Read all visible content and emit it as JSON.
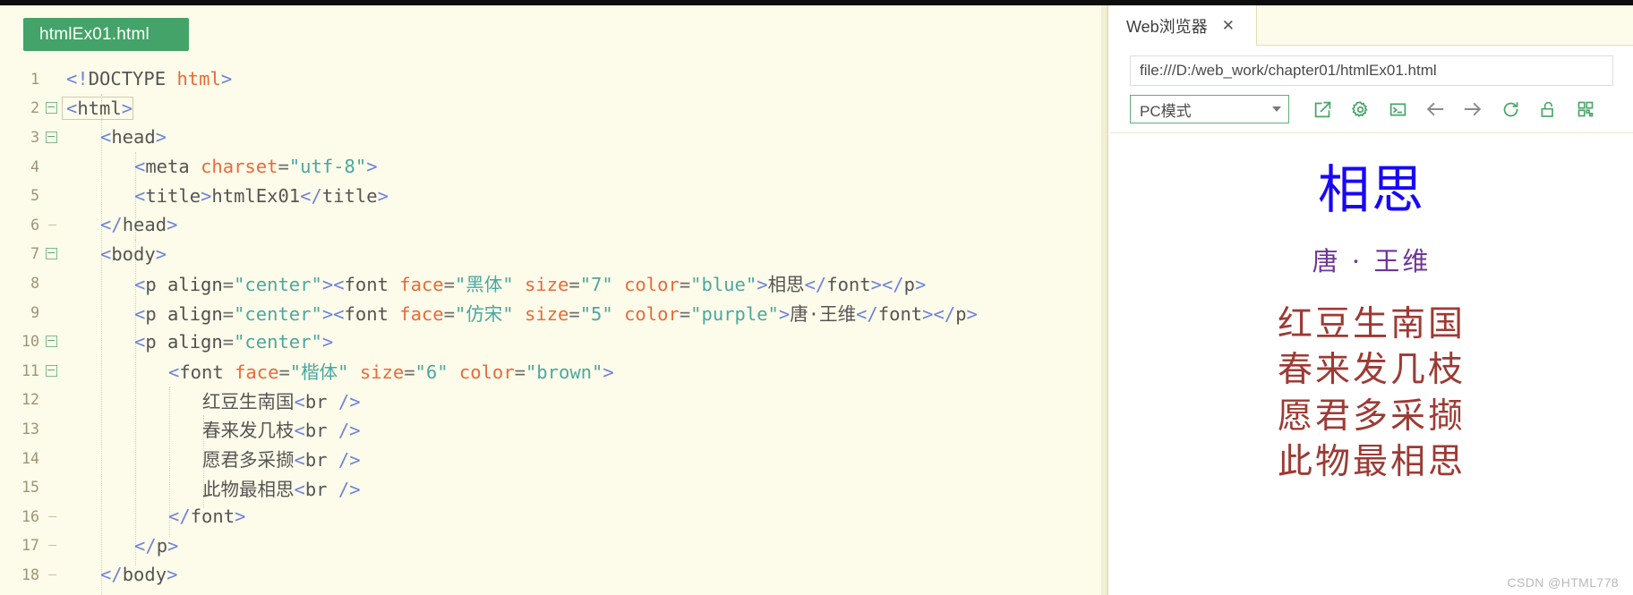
{
  "editor": {
    "file_tab_label": "htmlEx01.html",
    "lines": [
      {
        "n": "1",
        "fold": "none",
        "indent": 0,
        "tokens": [
          {
            "t": "punct",
            "v": "<!"
          },
          {
            "t": "tag",
            "v": "DOCTYPE "
          },
          {
            "t": "attr",
            "v": "html"
          },
          {
            "t": "punct",
            "v": ">"
          }
        ]
      },
      {
        "n": "2",
        "fold": "minus",
        "indent": 0,
        "boxed": true,
        "tokens": [
          {
            "t": "punct",
            "v": "<"
          },
          {
            "t": "tag",
            "v": "html"
          },
          {
            "t": "punct",
            "v": ">"
          }
        ]
      },
      {
        "n": "3",
        "fold": "minus",
        "indent": 1,
        "tokens": [
          {
            "t": "punct",
            "v": "<"
          },
          {
            "t": "tag",
            "v": "head"
          },
          {
            "t": "punct",
            "v": ">"
          }
        ]
      },
      {
        "n": "4",
        "fold": "none",
        "indent": 2,
        "tokens": [
          {
            "t": "punct",
            "v": "<"
          },
          {
            "t": "tag",
            "v": "meta "
          },
          {
            "t": "attr",
            "v": "charset"
          },
          {
            "t": "eq",
            "v": "="
          },
          {
            "t": "val",
            "v": "\"utf-8\""
          },
          {
            "t": "punct",
            "v": ">"
          }
        ]
      },
      {
        "n": "5",
        "fold": "none",
        "indent": 2,
        "tokens": [
          {
            "t": "punct",
            "v": "<"
          },
          {
            "t": "tag",
            "v": "title"
          },
          {
            "t": "punct",
            "v": ">"
          },
          {
            "t": "txt",
            "v": "htmlEx01"
          },
          {
            "t": "punct",
            "v": "</"
          },
          {
            "t": "tag",
            "v": "title"
          },
          {
            "t": "punct",
            "v": ">"
          }
        ]
      },
      {
        "n": "6",
        "fold": "tick",
        "indent": 1,
        "tokens": [
          {
            "t": "punct",
            "v": "</"
          },
          {
            "t": "tag",
            "v": "head"
          },
          {
            "t": "punct",
            "v": ">"
          }
        ]
      },
      {
        "n": "7",
        "fold": "minus",
        "indent": 1,
        "tokens": [
          {
            "t": "punct",
            "v": "<"
          },
          {
            "t": "tag",
            "v": "body"
          },
          {
            "t": "punct",
            "v": ">"
          }
        ]
      },
      {
        "n": "8",
        "fold": "none",
        "indent": 2,
        "tokens": [
          {
            "t": "punct",
            "v": "<"
          },
          {
            "t": "tag",
            "v": "p "
          },
          {
            "t": "dark",
            "v": "align"
          },
          {
            "t": "eq",
            "v": "="
          },
          {
            "t": "val",
            "v": "\"center\""
          },
          {
            "t": "punct",
            "v": ">"
          },
          {
            "t": "punct",
            "v": "<"
          },
          {
            "t": "tag",
            "v": "font "
          },
          {
            "t": "attr",
            "v": "face"
          },
          {
            "t": "eq",
            "v": "="
          },
          {
            "t": "val",
            "v": "\"黑体\""
          },
          {
            "t": "txt",
            "v": " "
          },
          {
            "t": "attr",
            "v": "size"
          },
          {
            "t": "eq",
            "v": "="
          },
          {
            "t": "val",
            "v": "\"7\""
          },
          {
            "t": "txt",
            "v": " "
          },
          {
            "t": "attr",
            "v": "color"
          },
          {
            "t": "eq",
            "v": "="
          },
          {
            "t": "val",
            "v": "\"blue\""
          },
          {
            "t": "punct",
            "v": ">"
          },
          {
            "t": "txt",
            "v": "相思"
          },
          {
            "t": "punct",
            "v": "</"
          },
          {
            "t": "tag",
            "v": "font"
          },
          {
            "t": "punct",
            "v": ">"
          },
          {
            "t": "punct",
            "v": "</"
          },
          {
            "t": "tag",
            "v": "p"
          },
          {
            "t": "punct",
            "v": ">"
          }
        ]
      },
      {
        "n": "9",
        "fold": "none",
        "indent": 2,
        "tokens": [
          {
            "t": "punct",
            "v": "<"
          },
          {
            "t": "tag",
            "v": "p "
          },
          {
            "t": "dark",
            "v": "align"
          },
          {
            "t": "eq",
            "v": "="
          },
          {
            "t": "val",
            "v": "\"center\""
          },
          {
            "t": "punct",
            "v": ">"
          },
          {
            "t": "punct",
            "v": "<"
          },
          {
            "t": "tag",
            "v": "font "
          },
          {
            "t": "attr",
            "v": "face"
          },
          {
            "t": "eq",
            "v": "="
          },
          {
            "t": "val",
            "v": "\"仿宋\""
          },
          {
            "t": "txt",
            "v": " "
          },
          {
            "t": "attr",
            "v": "size"
          },
          {
            "t": "eq",
            "v": "="
          },
          {
            "t": "val",
            "v": "\"5\""
          },
          {
            "t": "txt",
            "v": " "
          },
          {
            "t": "attr",
            "v": "color"
          },
          {
            "t": "eq",
            "v": "="
          },
          {
            "t": "val",
            "v": "\"purple\""
          },
          {
            "t": "punct",
            "v": ">"
          },
          {
            "t": "txt",
            "v": "唐·王维"
          },
          {
            "t": "punct",
            "v": "</"
          },
          {
            "t": "tag",
            "v": "font"
          },
          {
            "t": "punct",
            "v": ">"
          },
          {
            "t": "punct",
            "v": "</"
          },
          {
            "t": "tag",
            "v": "p"
          },
          {
            "t": "punct",
            "v": ">"
          }
        ]
      },
      {
        "n": "10",
        "fold": "minus",
        "indent": 2,
        "tokens": [
          {
            "t": "punct",
            "v": "<"
          },
          {
            "t": "tag",
            "v": "p "
          },
          {
            "t": "dark",
            "v": "align"
          },
          {
            "t": "eq",
            "v": "="
          },
          {
            "t": "val",
            "v": "\"center\""
          },
          {
            "t": "punct",
            "v": ">"
          }
        ]
      },
      {
        "n": "11",
        "fold": "minus",
        "indent": 3,
        "tokens": [
          {
            "t": "punct",
            "v": "<"
          },
          {
            "t": "tag",
            "v": "font "
          },
          {
            "t": "attr",
            "v": "face"
          },
          {
            "t": "eq",
            "v": "="
          },
          {
            "t": "val",
            "v": "\"楷体\""
          },
          {
            "t": "txt",
            "v": " "
          },
          {
            "t": "attr",
            "v": "size"
          },
          {
            "t": "eq",
            "v": "="
          },
          {
            "t": "val",
            "v": "\"6\""
          },
          {
            "t": "txt",
            "v": " "
          },
          {
            "t": "attr",
            "v": "color"
          },
          {
            "t": "eq",
            "v": "="
          },
          {
            "t": "val",
            "v": "\"brown\""
          },
          {
            "t": "punct",
            "v": ">"
          }
        ]
      },
      {
        "n": "12",
        "fold": "none",
        "indent": 4,
        "tokens": [
          {
            "t": "txt",
            "v": "红豆生南国"
          },
          {
            "t": "punct",
            "v": "<"
          },
          {
            "t": "tag",
            "v": "br"
          },
          {
            "t": "punct",
            "v": " />"
          }
        ]
      },
      {
        "n": "13",
        "fold": "none",
        "indent": 4,
        "tokens": [
          {
            "t": "txt",
            "v": "春来发几枝"
          },
          {
            "t": "punct",
            "v": "<"
          },
          {
            "t": "tag",
            "v": "br"
          },
          {
            "t": "punct",
            "v": " />"
          }
        ]
      },
      {
        "n": "14",
        "fold": "none",
        "indent": 4,
        "tokens": [
          {
            "t": "txt",
            "v": "愿君多采撷"
          },
          {
            "t": "punct",
            "v": "<"
          },
          {
            "t": "tag",
            "v": "br"
          },
          {
            "t": "punct",
            "v": " />"
          }
        ]
      },
      {
        "n": "15",
        "fold": "none",
        "indent": 4,
        "tokens": [
          {
            "t": "txt",
            "v": "此物最相思"
          },
          {
            "t": "punct",
            "v": "<"
          },
          {
            "t": "tag",
            "v": "br"
          },
          {
            "t": "punct",
            "v": " />"
          }
        ]
      },
      {
        "n": "16",
        "fold": "tick",
        "indent": 3,
        "tokens": [
          {
            "t": "punct",
            "v": "</"
          },
          {
            "t": "tag",
            "v": "font"
          },
          {
            "t": "punct",
            "v": ">"
          }
        ]
      },
      {
        "n": "17",
        "fold": "tick",
        "indent": 2,
        "tokens": [
          {
            "t": "punct",
            "v": "</"
          },
          {
            "t": "tag",
            "v": "p"
          },
          {
            "t": "punct",
            "v": ">"
          }
        ]
      },
      {
        "n": "18",
        "fold": "tick",
        "indent": 1,
        "tokens": [
          {
            "t": "punct",
            "v": "</"
          },
          {
            "t": "tag",
            "v": "body"
          },
          {
            "t": "punct",
            "v": ">"
          }
        ]
      }
    ]
  },
  "browser": {
    "tab_label": "Web浏览器",
    "tab_close_glyph": "✕",
    "url": "file:///D:/web_work/chapter01/htmlEx01.html",
    "mode_label": "PC模式",
    "toolbar_icons": [
      "open-external-icon",
      "settings-gear-icon",
      "console-icon",
      "back-arrow-icon",
      "forward-arrow-icon",
      "reload-icon",
      "unlock-icon",
      "qrcode-icon"
    ]
  },
  "preview": {
    "title": "相思",
    "author": "唐 · 王维",
    "poem_lines": [
      "红豆生南国",
      "春来发几枝",
      "愿君多采撷",
      "此物最相思"
    ]
  },
  "watermark": "CSDN @HTML778",
  "colors": {
    "tab_green": "#44a368",
    "editor_bg": "#fdfbe9",
    "title_blue": "#1808f5",
    "author_purple": "#6f3597",
    "poem_brown": "#9d3a33",
    "attr_orange": "#e86a3a",
    "value_teal": "#4aa8a0",
    "punct_blue": "#6b83e0"
  }
}
